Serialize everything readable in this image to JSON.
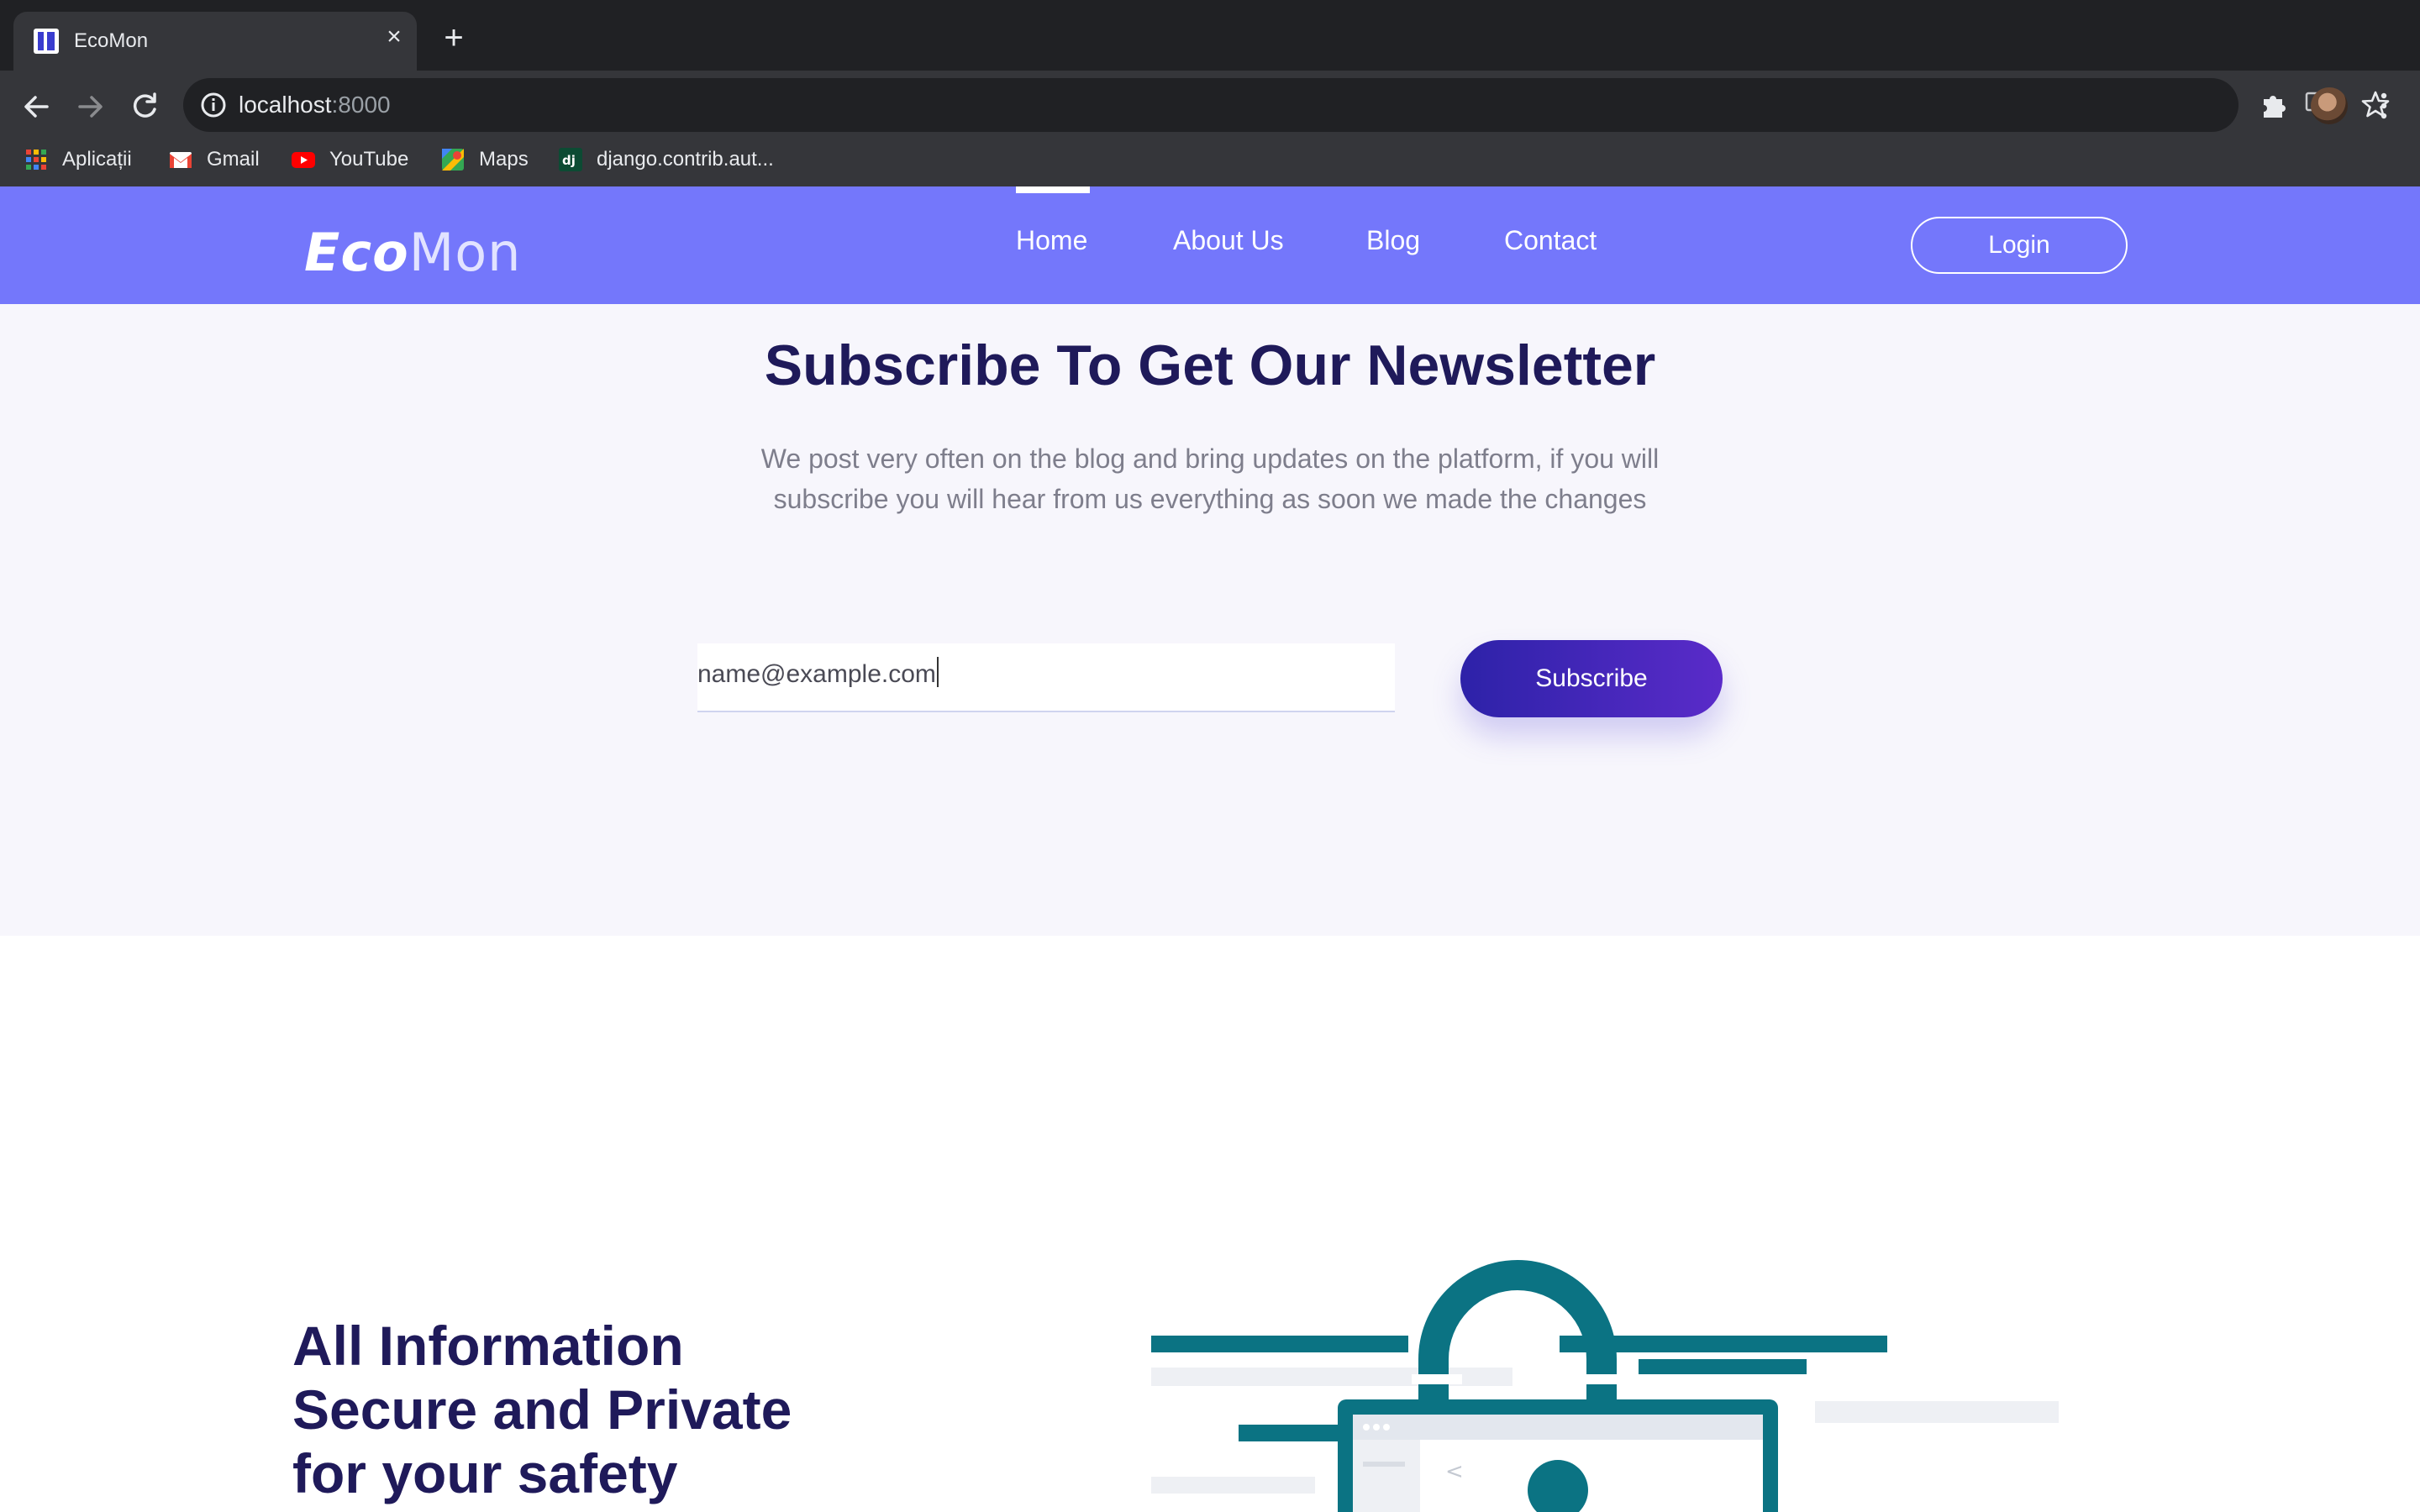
{
  "browser": {
    "tab_title": "EcoMon",
    "url_host": "localhost",
    "url_port": ":8000",
    "bookmarks": [
      {
        "label": "Aplicații",
        "icon": "apps-grid-icon"
      },
      {
        "label": "Gmail",
        "icon": "gmail-icon"
      },
      {
        "label": "YouTube",
        "icon": "youtube-icon"
      },
      {
        "label": "Maps",
        "icon": "maps-icon"
      },
      {
        "label": "django.contrib.aut...",
        "icon": "django-icon"
      }
    ]
  },
  "site": {
    "logo_bold": "Eco",
    "logo_light": "Mon",
    "nav": [
      {
        "label": "Home",
        "active": true
      },
      {
        "label": "About Us",
        "active": false
      },
      {
        "label": "Blog",
        "active": false
      },
      {
        "label": "Contact",
        "active": false
      }
    ],
    "login_label": "Login",
    "brand_color": "#7477fb"
  },
  "newsletter": {
    "title": "Subscribe To Get Our Newsletter",
    "description": "We post very often on the blog and bring updates on the platform, if you will subscribe you will hear from us everything as soon we made the changes",
    "email_value": "name@example.com",
    "subscribe_label": "Subscribe"
  },
  "security": {
    "title": "All Information Secure and Private for your safety",
    "illustration": "padlock-laptop-illustration"
  }
}
